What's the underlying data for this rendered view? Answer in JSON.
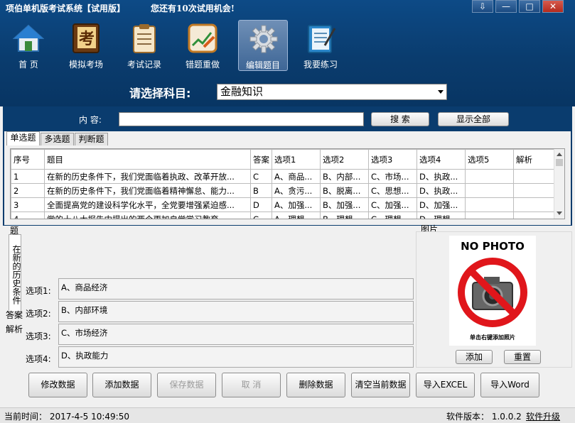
{
  "window": {
    "title": "项伯单机版考试系统【试用版】",
    "trial_notice": "您还有10次试用机会!",
    "controls": [
      "⇩",
      "—",
      "□",
      "✕"
    ]
  },
  "toolbar": {
    "items": [
      {
        "label": "首  页",
        "icon": "home-icon"
      },
      {
        "label": "模拟考场",
        "icon": "exam-book-icon"
      },
      {
        "label": "考试记录",
        "icon": "clipboard-icon"
      },
      {
        "label": "错题重做",
        "icon": "edit-pencil-icon"
      },
      {
        "label": "编辑题目",
        "icon": "gear-icon",
        "active": true
      },
      {
        "label": "我要练习",
        "icon": "notebook-icon"
      }
    ]
  },
  "subject": {
    "label": "请选择科目:",
    "selected": "金融知识"
  },
  "search": {
    "label": "内  容:",
    "value": "",
    "search_button": "搜   索",
    "show_all_button": "显示全部"
  },
  "tabs": [
    "单选题",
    "多选题",
    "判断题"
  ],
  "table": {
    "columns": [
      "序号",
      "题目",
      "答案",
      "选项1",
      "选项2",
      "选项3",
      "选项4",
      "选项5",
      "解析"
    ],
    "rows": [
      [
        "1",
        "在新的历史条件下，我们党面临着执政、改革开放...",
        "C",
        "A、商品...",
        "B、内部...",
        "C、市场...",
        "D、执政...",
        "",
        ""
      ],
      [
        "2",
        "在新的历史条件下，我们党面临着精神懈怠、能力...",
        "B",
        "A、贪污...",
        "B、脱离...",
        "C、思想...",
        "D、执政...",
        "",
        ""
      ],
      [
        "3",
        "全面提高党的建设科学化水平，全党要增强紧迫感...",
        "D",
        "A、加强...",
        "B、加强...",
        "C、加强...",
        "D、加强...",
        "",
        ""
      ],
      [
        "4",
        "党的十八大报告中提出的两个更加自觉学习教育...",
        "C",
        "A、理想...",
        "B、理想...",
        "C、理想...",
        "D、理想...",
        "",
        ""
      ]
    ]
  },
  "detail": {
    "question_label": "题",
    "question_text": "在新的历史条件",
    "answer_label": "答案",
    "analysis_label": "解析",
    "options": [
      {
        "label": "选项1:",
        "value": "A、商品经济"
      },
      {
        "label": "选项2:",
        "value": "B、内部环境"
      },
      {
        "label": "选项3:",
        "value": "C、市场经济"
      },
      {
        "label": "选项4:",
        "value": "D、执政能力"
      }
    ]
  },
  "picture": {
    "label": "图片",
    "placeholder_title": "NO PHOTO",
    "placeholder_hint": "单击右键添加照片",
    "add_button": "添加",
    "reset_button": "重置"
  },
  "actions": [
    {
      "label": "修改数据",
      "enabled": true
    },
    {
      "label": "添加数据",
      "enabled": true
    },
    {
      "label": "保存数据",
      "enabled": false
    },
    {
      "label": "取  消",
      "enabled": false
    },
    {
      "label": "删除数据",
      "enabled": true
    },
    {
      "label": "清空当前数据",
      "enabled": true
    },
    {
      "label": "导入EXCEL",
      "enabled": true
    },
    {
      "label": "导入Word",
      "enabled": true
    }
  ],
  "status": {
    "time": "当前时间： 2017-4-5 10:49:50",
    "version": "软件版本： 1.0.0.2",
    "upgrade": "软件升级"
  },
  "colors": {
    "header_bg": "#0a3c6e",
    "no_photo_red": "#e0161b"
  }
}
